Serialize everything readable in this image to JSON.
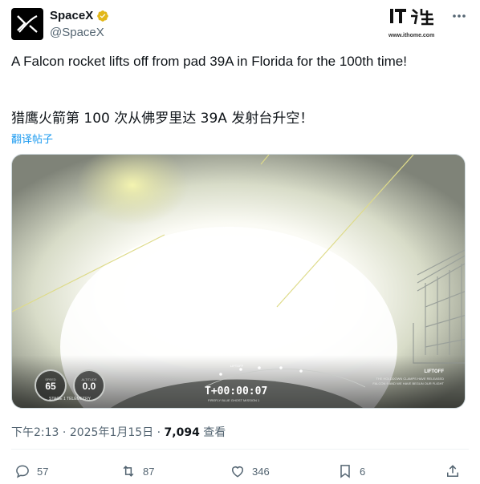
{
  "author": {
    "display_name": "SpaceX",
    "handle": "@SpaceX",
    "avatar_icon": "spacex-x-logo",
    "verified_icon": "verified-badge-icon",
    "verified_color": "#e2b719"
  },
  "watermark": {
    "logo_text": "IT之家",
    "url": "www.ithome.com"
  },
  "more_icon": "more-horizontal-icon",
  "tweet": {
    "text": "A Falcon rocket lifts off from pad 39A in Florida for the 100th time!",
    "text_zh": "猎鹰火箭第 100 次从佛罗里达 39A 发射台升空！",
    "translate_label": "翻译帖子"
  },
  "video_overlay": {
    "speed_label": "SPEED",
    "speed_value": "65",
    "altitude_label": "ALTITUDE",
    "altitude_value": "0.0",
    "stage_label": "STAGE 1 TELEMETRY",
    "timer": "T+00:00:07",
    "mission": "FIREFLY BLUE GHOST MISSION 1",
    "event_liftoff": "LIFTOFF",
    "event_status_title": "LIFTOFF",
    "event_status_line1": "THE HOLDDOWN CLAMPS HAVE RELEASED",
    "event_status_line2": "FALCON 9 AND WE HAVE BEGUN OUR FLIGHT"
  },
  "meta": {
    "time": "下午2:13",
    "date": "2025年1月15日",
    "separator": "·",
    "views": "7,094",
    "views_label": "查看"
  },
  "actions": {
    "replies": "57",
    "reposts": "87",
    "likes": "346",
    "bookmarks": "6"
  },
  "colors": {
    "link": "#1d9bf0",
    "secondary_text": "#536471",
    "primary_text": "#0f1419"
  }
}
